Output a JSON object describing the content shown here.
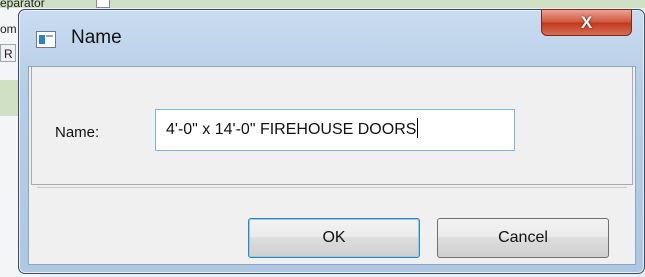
{
  "background": {
    "fragment_top": "eparator",
    "fragment_mid": "om",
    "fragment_r": "R"
  },
  "dialog": {
    "title": "Name",
    "close_glyph": "X",
    "icon": "window-icon",
    "field_label": "Name:",
    "field_value": "4'-0\" x 14'-0\" FIREHOUSE DOORS",
    "ok_label": "OK",
    "cancel_label": "Cancel"
  },
  "colors": {
    "accent_focus": "#7eb4ea",
    "close_red": "#c1391d"
  }
}
